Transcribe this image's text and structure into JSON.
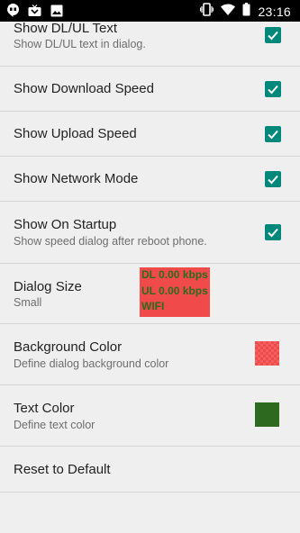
{
  "status_bar": {
    "time": "23:16",
    "left_icons": [
      "hangouts-icon",
      "tv-icon",
      "image-icon"
    ],
    "right_icons": [
      "vibrate-icon",
      "wifi-icon",
      "battery-icon"
    ]
  },
  "settings": {
    "show_text": {
      "title": "Show DL/UL Text",
      "summary": "Show DL/UL text in dialog.",
      "checked": true
    },
    "show_download": {
      "title": "Show Download Speed",
      "checked": true
    },
    "show_upload": {
      "title": "Show Upload Speed",
      "checked": true
    },
    "show_network": {
      "title": "Show Network Mode",
      "checked": true
    },
    "show_startup": {
      "title": "Show On Startup",
      "summary": "Show speed dialog after reboot phone.",
      "checked": true
    },
    "dialog_size": {
      "title": "Dialog Size",
      "summary": "Small",
      "preview": {
        "line1": "DL 0.00 kbps",
        "line2": "UL 0.00 kbps",
        "line3": "WIFI"
      }
    },
    "background_color": {
      "title": "Background Color",
      "summary": "Define dialog background color",
      "color": "#f04a4a"
    },
    "text_color": {
      "title": "Text Color",
      "summary": "Define text color",
      "color": "#2d6a1f"
    },
    "reset": {
      "title": "Reset to Default"
    }
  },
  "colors": {
    "accent": "#00897b",
    "background": "#efefef"
  }
}
